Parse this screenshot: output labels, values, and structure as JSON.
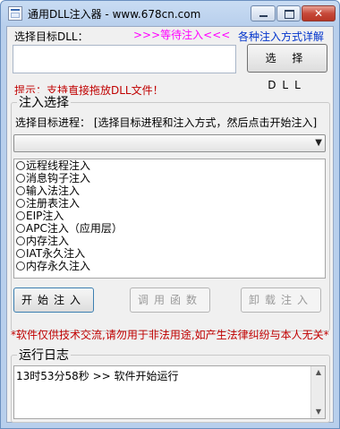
{
  "window": {
    "title": "通用DLL注入器 - www.678cn.com",
    "controls": {
      "minimize": "minimize",
      "maximize": "maximize",
      "close": "✕"
    }
  },
  "dll": {
    "label": "选择目标DLL：",
    "status": ">>>等待注入<<<",
    "methods_link": "各种注入方式详解",
    "path_value": "",
    "select_button": "选 择 DLL",
    "hint": "提示：支持直接拖放DLL文件！"
  },
  "inject": {
    "group_title": "注入选择",
    "target_label": "选择目标进程：  [选择目标进程和注入方式，然后点击开始注入]",
    "process_selected": "",
    "methods": [
      "远程线程注入",
      "消息钩子注入",
      "输入法注入",
      "注册表注入",
      "EIP注入",
      "APC注入（应用层）",
      "内存注入",
      "IAT永久注入",
      "内存永久注入"
    ],
    "buttons": {
      "start": "开始注入",
      "call": "调用函数",
      "unload": "卸载注入"
    }
  },
  "disclaimer": "*软件仅供技术交流,请勿用于非法用途,如产生法律纠纷与本人无关*",
  "log": {
    "group_title": "运行日志",
    "entries": [
      "13时53分58秒 >> 软件开始运行"
    ]
  },
  "colors": {
    "status_magenta": "#ff00ff",
    "link_blue": "#0033cc",
    "warning_red": "#c00000"
  }
}
